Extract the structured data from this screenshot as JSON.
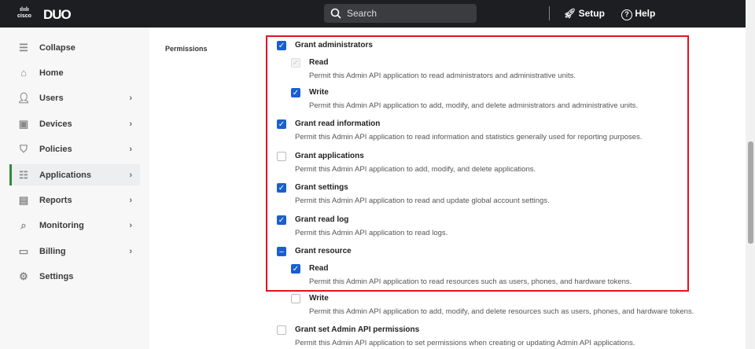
{
  "header": {
    "brand": "cisco",
    "product": "DUO",
    "search_placeholder": "Search",
    "setup": "Setup",
    "help": "Help"
  },
  "sidebar": {
    "items": [
      {
        "label": "Collapse",
        "icon": "menu-icon",
        "chevron": false
      },
      {
        "label": "Home",
        "icon": "home-icon",
        "chevron": false
      },
      {
        "label": "Users",
        "icon": "users-icon",
        "chevron": true
      },
      {
        "label": "Devices",
        "icon": "devices-icon",
        "chevron": true
      },
      {
        "label": "Policies",
        "icon": "shield-icon",
        "chevron": true
      },
      {
        "label": "Applications",
        "icon": "applications-icon",
        "chevron": true,
        "active": true
      },
      {
        "label": "Reports",
        "icon": "reports-icon",
        "chevron": true
      },
      {
        "label": "Monitoring",
        "icon": "monitoring-icon",
        "chevron": true
      },
      {
        "label": "Billing",
        "icon": "billing-icon",
        "chevron": true
      },
      {
        "label": "Settings",
        "icon": "gear-icon",
        "chevron": false
      }
    ]
  },
  "permissions": {
    "label": "Permissions",
    "items": [
      {
        "title": "Grant administrators",
        "desc": "",
        "state": "checked",
        "level": 0
      },
      {
        "title": "Read",
        "desc": "Permit this Admin API application to read administrators and administrative units.",
        "state": "disabled",
        "level": 1
      },
      {
        "title": "Write",
        "desc": "Permit this Admin API application to add, modify, and delete administrators and administrative units.",
        "state": "checked",
        "level": 1
      },
      {
        "title": "Grant read information",
        "desc": "Permit this Admin API application to read information and statistics generally used for reporting purposes.",
        "state": "checked",
        "level": 0
      },
      {
        "title": "Grant applications",
        "desc": "Permit this Admin API application to add, modify, and delete applications.",
        "state": "unchecked",
        "level": 0
      },
      {
        "title": "Grant settings",
        "desc": "Permit this Admin API application to read and update global account settings.",
        "state": "checked",
        "level": 0
      },
      {
        "title": "Grant read log",
        "desc": "Permit this Admin API application to read logs.",
        "state": "checked",
        "level": 0
      },
      {
        "title": "Grant resource",
        "desc": "",
        "state": "indeterminate",
        "level": 0
      },
      {
        "title": "Read",
        "desc": "Permit this Admin API application to read resources such as users, phones, and hardware tokens.",
        "state": "checked",
        "level": 1
      },
      {
        "title": "Write",
        "desc": "Permit this Admin API application to add, modify, and delete resources such as users, phones, and hardware tokens.",
        "state": "unchecked",
        "level": 1
      },
      {
        "title": "Grant set Admin API permissions",
        "desc": "Permit this Admin API application to set permissions when creating or updating Admin API applications.",
        "state": "unchecked",
        "level": 0
      }
    ]
  },
  "colors": {
    "accent": "#1a5fd0",
    "highlight": "#e0141e",
    "active_nav": "#2e8b3a"
  }
}
